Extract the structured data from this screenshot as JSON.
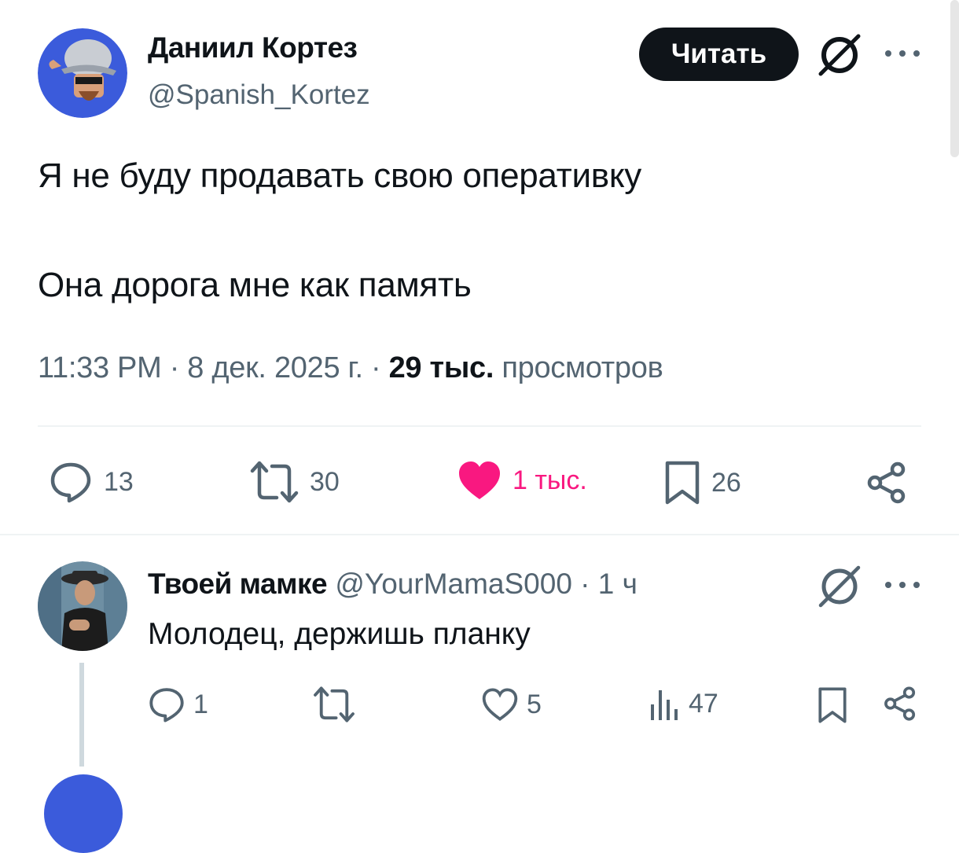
{
  "tweet": {
    "author_name": "Даниил Кортез",
    "author_handle": "@Spanish_Kortez",
    "follow_label": "Читать",
    "text_line1": "Я не буду продавать свою оперативку",
    "text_line2": "Она дорога мне как память",
    "time": "11:33 PM · 8 дек. 2025 г. · ",
    "views_count": "29 тыс.",
    "views_label": " просмотров",
    "actions": {
      "replies": "13",
      "retweets": "30",
      "likes": "1 тыс.",
      "bookmarks": "26"
    },
    "icons": [
      "avatar",
      "grok-icon",
      "more-icon",
      "reply-icon",
      "retweet-icon",
      "heart-icon",
      "bookmark-icon",
      "share-icon"
    ]
  },
  "reply": {
    "author_name": "Твоей мамке",
    "author_handle": " @YourMamaS000 · 1 ч",
    "text": "Молодец, держишь планку",
    "actions": {
      "replies": "1",
      "likes": "5",
      "views": "47"
    },
    "icons": [
      "grok-icon",
      "more-icon",
      "reply-icon",
      "retweet-icon",
      "heart-icon",
      "views-icon",
      "bookmark-icon",
      "share-icon"
    ]
  },
  "colors": {
    "text": "#0f1419",
    "secondary": "#536471",
    "like": "#f91880",
    "divider": "#eff3f4",
    "avatar_bg": "#3b5bdb"
  }
}
